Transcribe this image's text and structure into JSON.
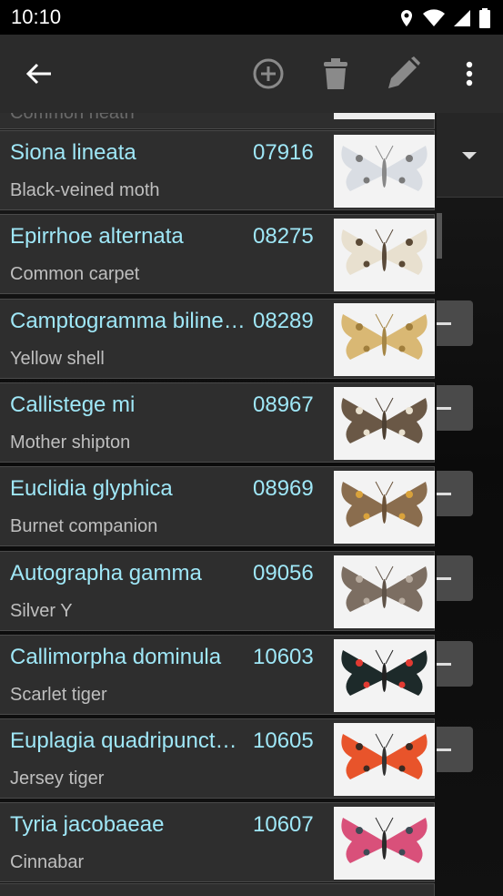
{
  "status": {
    "time": "10:10"
  },
  "toolbar": {
    "back_icon": "arrow-left-icon",
    "add_icon": "add-circle-icon",
    "delete_icon": "trash-icon",
    "edit_icon": "pencil-icon",
    "more_icon": "more-vert-icon"
  },
  "list": {
    "partial_top_text": "Common heath",
    "items": [
      {
        "scientific": "Siona lineata",
        "number": "07916",
        "common": "Black-veined moth",
        "wing": "#d9dde3",
        "mark": "#7a7a7a",
        "body": "#888"
      },
      {
        "scientific": "Epirrhoe alternata",
        "number": "08275",
        "common": "Common carpet",
        "wing": "#e8e0cf",
        "mark": "#5b4a36",
        "body": "#5a4a3a"
      },
      {
        "scientific": "Camptogramma bilineata",
        "number": "08289",
        "common": "Yellow shell",
        "wing": "#d9b874",
        "mark": "#a07e3c",
        "body": "#a58646"
      },
      {
        "scientific": "Callistege mi",
        "number": "08967",
        "common": "Mother shipton",
        "wing": "#6a5846",
        "mark": "#e9e1cf",
        "body": "#4d4033"
      },
      {
        "scientific": "Euclidia glyphica",
        "number": "08969",
        "common": "Burnet companion",
        "wing": "#8a6d4e",
        "mark": "#d9a23b",
        "body": "#6b5238"
      },
      {
        "scientific": "Autographa gamma",
        "number": "09056",
        "common": "Silver Y",
        "wing": "#7c6e62",
        "mark": "#b8aca0",
        "body": "#5f5348"
      },
      {
        "scientific": "Callimorpha dominula",
        "number": "10603",
        "common": "Scarlet tiger",
        "wing": "#1d2a2a",
        "mark": "#e23a32",
        "body": "#222"
      },
      {
        "scientific": "Euplagia quadripunctaria",
        "number": "10605",
        "common": "Jersey tiger",
        "wing": "#e8542b",
        "mark": "#3b2a22",
        "body": "#333"
      },
      {
        "scientific": "Tyria jacobaeae",
        "number": "10607",
        "common": "Cinnabar",
        "wing": "#d9507a",
        "mark": "#3f4a55",
        "body": "#2a2a2a"
      }
    ]
  }
}
